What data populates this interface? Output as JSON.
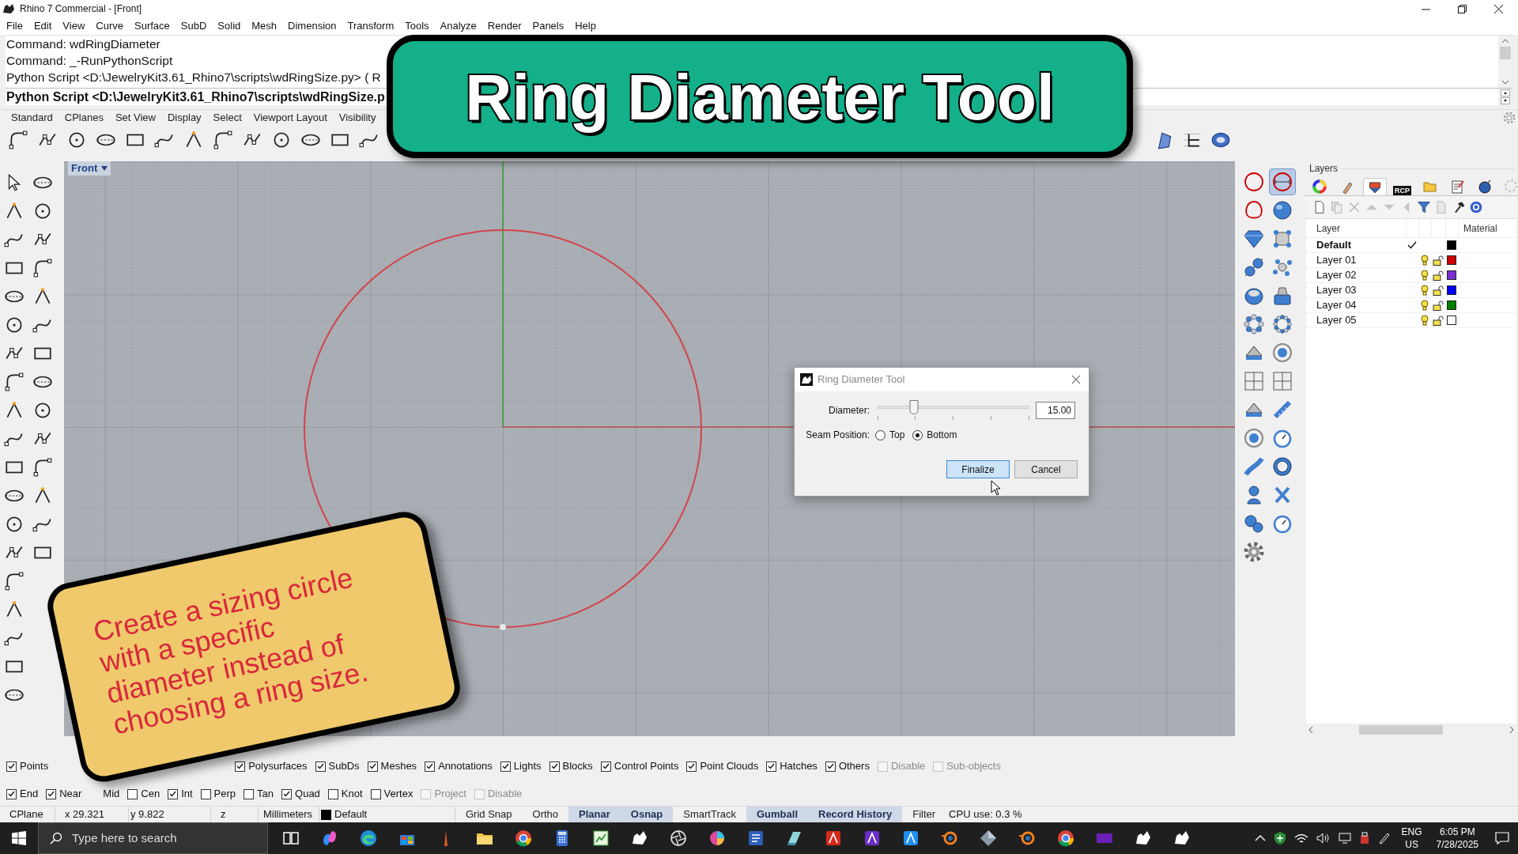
{
  "window": {
    "title": "Rhino 7 Commercial - [Front]"
  },
  "menu": [
    "File",
    "Edit",
    "View",
    "Curve",
    "Surface",
    "SubD",
    "Solid",
    "Mesh",
    "Dimension",
    "Transform",
    "Tools",
    "Analyze",
    "Render",
    "Panels",
    "Help"
  ],
  "command_history": [
    "Command: wdRingDiameter",
    "Command: _-RunPythonScript",
    "Python Script <D:\\JewelryKit3.61_Rhino7\\scripts\\wdRingSize.py> ( R"
  ],
  "command_prompt": "Python Script <D:\\JewelryKit3.61_Rhino7\\scripts\\wdRingSize.p",
  "toolbar_tabs": [
    "Standard",
    "CPlanes",
    "Set View",
    "Display",
    "Select",
    "Viewport Layout",
    "Visibility"
  ],
  "title_banner": {
    "text": "Ring Diameter Tool"
  },
  "viewport": {
    "label": "Front"
  },
  "jewelry_toolbar": [
    {
      "selected": false
    },
    {
      "selected": true
    },
    {
      "selected": false
    },
    {
      "selected": false
    },
    {
      "selected": false
    },
    {
      "selected": false
    },
    {
      "selected": false
    },
    {
      "selected": false
    },
    {
      "selected": false
    },
    {
      "selected": false
    },
    {
      "selected": false
    },
    {
      "selected": false
    },
    {
      "selected": false
    },
    {
      "selected": false
    },
    {
      "selected": false
    },
    {
      "selected": false
    },
    {
      "selected": false
    },
    {
      "selected": false
    },
    {
      "selected": false
    },
    {
      "selected": false
    },
    {
      "selected": false
    },
    {
      "selected": false
    },
    {
      "selected": false
    },
    {
      "selected": false
    },
    {
      "selected": false
    },
    {
      "selected": false
    },
    {
      "selected": false
    }
  ],
  "layers_panel": {
    "title": "Layers",
    "tabs": [
      {
        "kind": "color-wheel",
        "selected": false
      },
      {
        "kind": "brush",
        "selected": false
      },
      {
        "kind": "layers",
        "selected": true
      },
      {
        "kind": "text",
        "label": "RCP",
        "selected": false
      },
      {
        "kind": "folder",
        "selected": false
      },
      {
        "kind": "notepad",
        "selected": false
      },
      {
        "kind": "sphere",
        "selected": false
      }
    ],
    "columns": [
      "Layer",
      "Material"
    ],
    "rows": [
      {
        "name": "Default",
        "current": true,
        "color": "#000000"
      },
      {
        "name": "Layer 01",
        "current": false,
        "color": "#cc0000"
      },
      {
        "name": "Layer 02",
        "current": false,
        "color": "#7b2fd0"
      },
      {
        "name": "Layer 03",
        "current": false,
        "color": "#0000ff"
      },
      {
        "name": "Layer 04",
        "current": false,
        "color": "#008000"
      },
      {
        "name": "Layer 05",
        "current": false,
        "color": "#ffffff"
      }
    ]
  },
  "dialog": {
    "title": "Ring Diameter Tool",
    "diameter_label": "Diameter:",
    "diameter_slider": {
      "level": 0.24
    },
    "diameter_value": "15.00",
    "seam_label": "Seam Position:",
    "seam_options": [
      {
        "label": "Top",
        "selected": false
      },
      {
        "label": "Bottom",
        "selected": true
      }
    ],
    "buttons": [
      {
        "label": "Finalize",
        "kind": "default"
      },
      {
        "label": "Cancel",
        "kind": "normal"
      }
    ]
  },
  "object_filters": [
    {
      "label": "Points",
      "checked": true,
      "disabled": false
    },
    {
      "label": "Polysurfaces",
      "checked": true,
      "disabled": false
    },
    {
      "label": "SubDs",
      "checked": true,
      "disabled": false
    },
    {
      "label": "Meshes",
      "checked": true,
      "disabled": false
    },
    {
      "label": "Annotations",
      "checked": true,
      "disabled": false
    },
    {
      "label": "Lights",
      "checked": true,
      "disabled": false
    },
    {
      "label": "Blocks",
      "checked": true,
      "disabled": false
    },
    {
      "label": "Control Points",
      "checked": true,
      "disabled": false
    },
    {
      "label": "Point Clouds",
      "checked": true,
      "disabled": false
    },
    {
      "label": "Hatches",
      "checked": true,
      "disabled": false
    },
    {
      "label": "Others",
      "checked": true,
      "disabled": false
    },
    {
      "label": "Disable",
      "checked": false,
      "disabled": true
    },
    {
      "label": "Sub-objects",
      "checked": false,
      "disabled": true
    }
  ],
  "osnaps": [
    {
      "label": "End",
      "checked": true,
      "disabled": false
    },
    {
      "label": "Near",
      "checked": true,
      "disabled": false
    },
    {
      "label": "Mid",
      "disabled": false
    },
    {
      "label": "Cen",
      "checked": false,
      "disabled": false
    },
    {
      "label": "Int",
      "checked": true,
      "disabled": false
    },
    {
      "label": "Perp",
      "checked": false,
      "disabled": false
    },
    {
      "label": "Tan",
      "checked": false,
      "disabled": false
    },
    {
      "label": "Quad",
      "checked": true,
      "disabled": false
    },
    {
      "label": "Knot",
      "checked": false,
      "disabled": false
    },
    {
      "label": "Vertex",
      "checked": false,
      "disabled": false
    },
    {
      "label": "Project",
      "checked": false,
      "disabled": true
    },
    {
      "label": "Disable",
      "checked": false,
      "disabled": true
    }
  ],
  "status_bar": {
    "cplane": "CPlane",
    "x": "x 29.321",
    "y": "y 9.822",
    "z": "z",
    "units": "Millimeters",
    "layer": {
      "name": "Default",
      "color": "#000000"
    },
    "toggles": [
      {
        "label": "Grid Snap",
        "on": false
      },
      {
        "label": "Ortho",
        "on": false
      },
      {
        "label": "Planar",
        "on": true
      },
      {
        "label": "Osnap",
        "on": true
      },
      {
        "label": "SmartTrack",
        "on": false
      },
      {
        "label": "Gumball",
        "on": true
      },
      {
        "label": "Record History",
        "on": true
      },
      {
        "label": "Filter",
        "on": false
      }
    ],
    "cpu": "CPU use: 0.3 %"
  },
  "note_card": {
    "text": "Create a sizing circle\nwith a specific\ndiameter instead of\nchoosing a ring size."
  },
  "taskbar": {
    "search": {
      "placeholder": "Type here to search"
    },
    "language": "ENG",
    "region": "US",
    "time": "6:05 PM",
    "date": "7/28/2025"
  }
}
